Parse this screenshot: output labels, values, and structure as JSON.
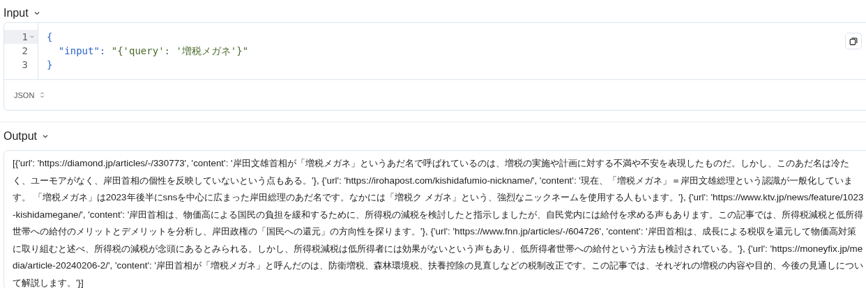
{
  "input": {
    "title": "Input",
    "expanded": true,
    "lines": [
      {
        "number": "1",
        "active": true,
        "foldable": true,
        "tokens": [
          {
            "kind": "punct",
            "text": "{"
          }
        ]
      },
      {
        "number": "2",
        "active": false,
        "foldable": false,
        "tokens": [
          {
            "kind": "key",
            "text": "  \"input\""
          },
          {
            "kind": "punct",
            "text": ": "
          },
          {
            "kind": "string",
            "text": "\"{'query': '増税メガネ'}\""
          }
        ]
      },
      {
        "number": "3",
        "active": false,
        "foldable": false,
        "tokens": [
          {
            "kind": "punct",
            "text": "}"
          }
        ]
      }
    ],
    "language": "JSON"
  },
  "output": {
    "title": "Output",
    "expanded": true,
    "text": "[{'url': 'https://diamond.jp/articles/-/330773', 'content': '岸田文雄首相が「増税メガネ」というあだ名で呼ばれているのは、増税の実施や計画に対する不満や不安を表現したものだ。しかし、このあだ名は冷たく、ユーモアがなく、岸田首相の個性を反映していないという点もある。'}, {'url': 'https://irohapost.com/kishidafumio-nickname/', 'content': '現在、「増税メガネ」＝岸田文雄総理という認識が一般化しています。 「増税メガネ」は2023年後半にsnsを中心に広まった岸田総理のあだ名です。なかには「増税ク メガネ」という、強烈なニックネームを使用する人もいます。'}, {'url': 'https://www.ktv.jp/news/feature/1023-kishidamegane/', 'content': '岸田首相は、物価高による国民の負担を緩和するために、所得税の減税を検討したと指示しましたが、自民党内には給付を求める声もあります。この記事では、所得税減税と低所得世帯への給付のメリットとデメリットを分析し、岸田政権の「国民への還元」の方向性を探ります。'}, {'url': 'https://www.fnn.jp/articles/-/604726', 'content': '岸田首相は、成長による税収を還元して物価高対策に取り組むと述べ、所得税の減税が念頭にあるとみられる。しかし、所得税減税は低所得者には効果がないという声もあり、低所得者世帯への給付という方法も検討されている。'}, {'url': 'https://moneyfix.jp/media/article-20240206-2/', 'content': '岸田首相が「増税メガネ」と呼んだのは、防衛増税、森林環境税、扶養控除の見直しなどの税制改正です。この記事では、それぞれの増税の内容や目的、今後の見通しについて解説します。'}]"
  }
}
